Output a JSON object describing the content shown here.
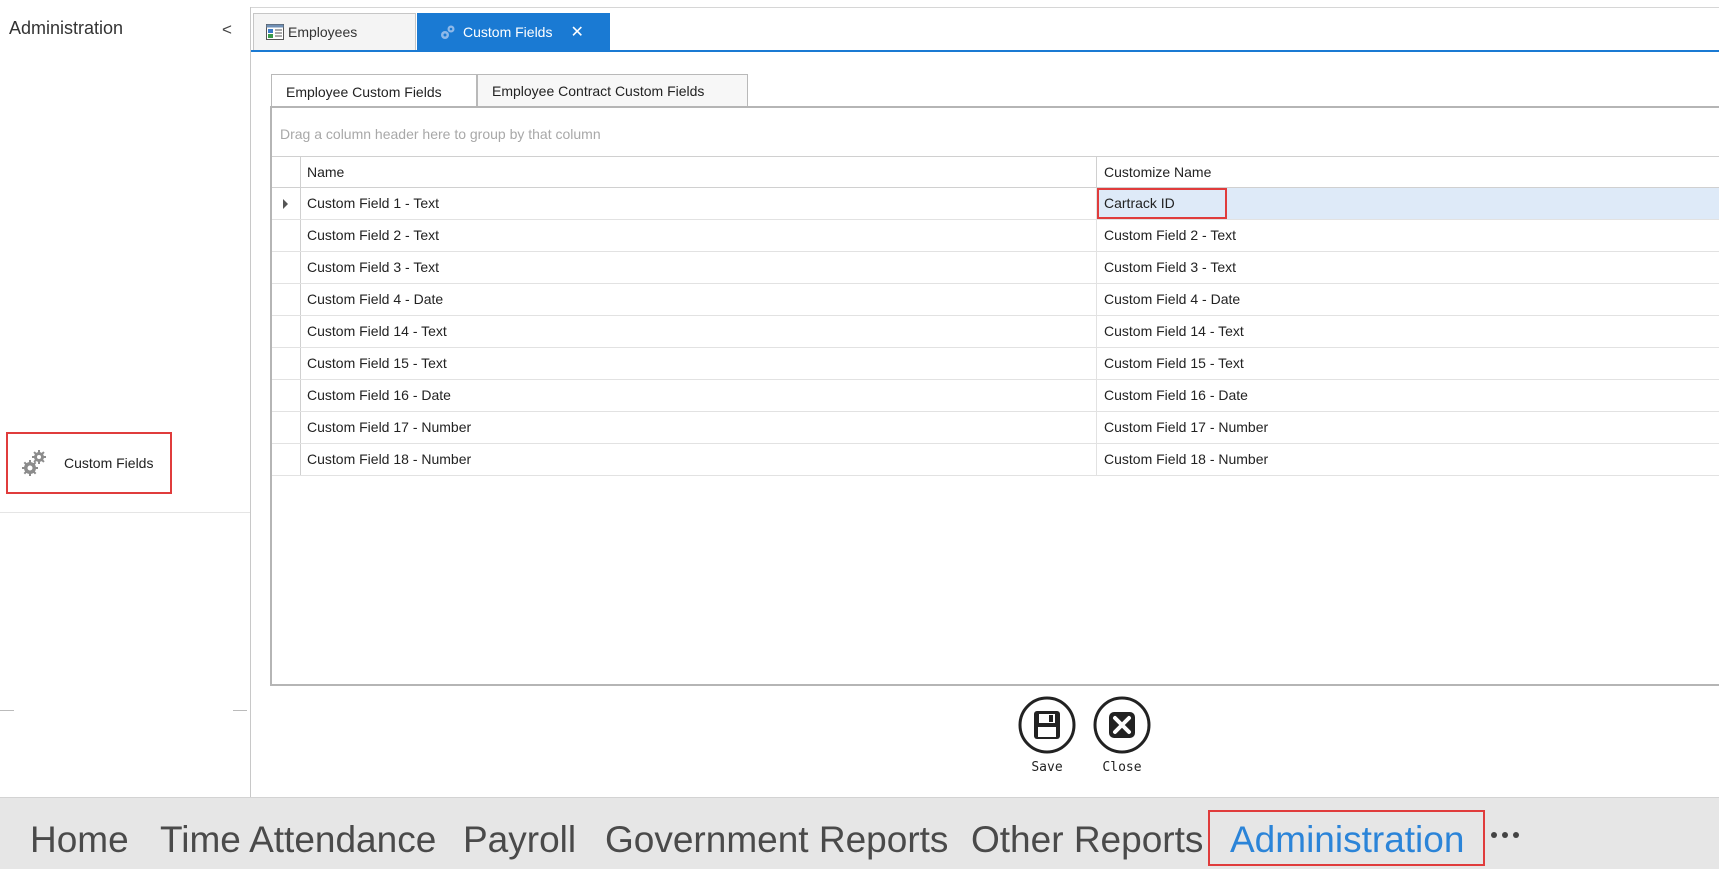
{
  "sidebar": {
    "title": "Administration",
    "collapse_glyph": "<",
    "items": [
      {
        "label": "Custom Fields",
        "icon": "gears-icon"
      }
    ]
  },
  "doc_tabs": [
    {
      "label": "Employees",
      "icon": "employees-grid-icon",
      "active": false
    },
    {
      "label": "Custom Fields",
      "icon": "gears-icon",
      "active": true,
      "close_glyph": "✕"
    }
  ],
  "inner_tabs": [
    {
      "label": "Employee Custom Fields",
      "active": true
    },
    {
      "label": "Employee Contract Custom Fields",
      "active": false
    }
  ],
  "grid": {
    "group_panel_hint": "Drag a column header here to group by that column",
    "columns": [
      "Name",
      "Customize Name"
    ],
    "rows": [
      {
        "name": "Custom Field 1 - Text",
        "customize_name": "Cartrack ID"
      },
      {
        "name": "Custom Field 2 - Text",
        "customize_name": "Custom Field 2 - Text"
      },
      {
        "name": "Custom Field 3 - Text",
        "customize_name": "Custom Field 3 - Text"
      },
      {
        "name": "Custom Field 4 - Date",
        "customize_name": "Custom Field 4 - Date"
      },
      {
        "name": "Custom Field 14 - Text",
        "customize_name": "Custom Field 14 - Text"
      },
      {
        "name": "Custom Field 15 - Text",
        "customize_name": "Custom Field 15 - Text"
      },
      {
        "name": "Custom Field 16 - Date",
        "customize_name": "Custom Field 16 - Date"
      },
      {
        "name": "Custom Field 17 - Number",
        "customize_name": "Custom Field 17 - Number"
      },
      {
        "name": "Custom Field 18 - Number",
        "customize_name": "Custom Field 18 - Number"
      }
    ]
  },
  "actions": {
    "save_label": "Save",
    "close_label": "Close"
  },
  "ribbon": {
    "items": [
      "Home",
      "Time Attendance",
      "Payroll",
      "Government Reports",
      "Other Reports",
      "Administration"
    ],
    "active": "Administration",
    "more_icon": "more-dots-icon"
  },
  "colors": {
    "accent": "#1a7ad3",
    "ribbon_active": "#2b84d8",
    "highlight": "#e03c3c",
    "focused_cell": "#deeaf8"
  }
}
